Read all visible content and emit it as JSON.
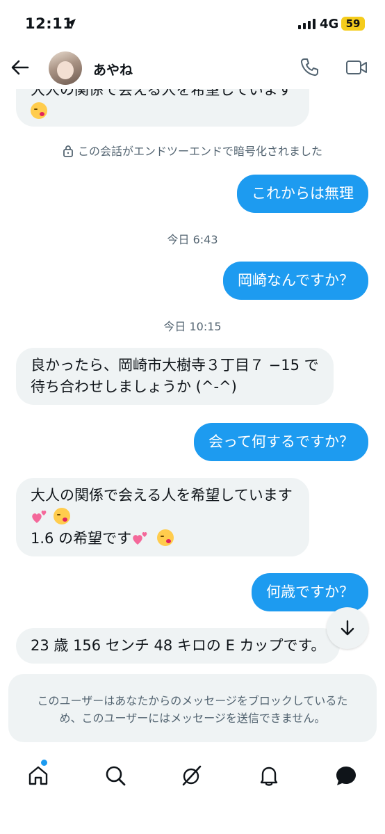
{
  "status_bar": {
    "time": "12:11",
    "network": "4G",
    "battery": "59"
  },
  "header": {
    "name": "あやね"
  },
  "messages": {
    "cutoff_line1": "大人の関係で会える人を希望しています",
    "e2e_notice": "この会話がエンドツーエンドで暗号化されました",
    "m1": "これからは無理",
    "ts1": "今日 6:43",
    "m2": "岡崎なんですか？",
    "ts2": "今日 10:15",
    "m3_line1": "良かったら、岡崎市大樹寺３丁目７ −15 で",
    "m3_line2": "待ち合わせしましょうか (^-^)",
    "m4": "会って何するですか？",
    "m5_line1": "大人の関係で会える人を希望しています",
    "m5_line3": "1.6 の希望です",
    "m6": "何歳ですか？",
    "m7": "23 歳 156 センチ 48 キロの E カップです。"
  },
  "blocked_notice": {
    "line1": "このユーザーはあなたからのメッセージをブロックしているた",
    "line2": "め、このユーザーにはメッセージを送信できません。"
  },
  "icons": {
    "back": "arrow-left-icon",
    "call": "phone-icon",
    "video": "video-camera-icon",
    "lock": "lock-icon",
    "scroll": "arrow-down-icon",
    "nav": [
      "home-icon",
      "search-icon",
      "grok-icon",
      "bell-icon",
      "messages-icon"
    ]
  },
  "colors": {
    "accent": "#1d9bf0",
    "received_bubble": "#eff3f4",
    "muted_text": "#536471",
    "battery": "#f5cc1c"
  }
}
